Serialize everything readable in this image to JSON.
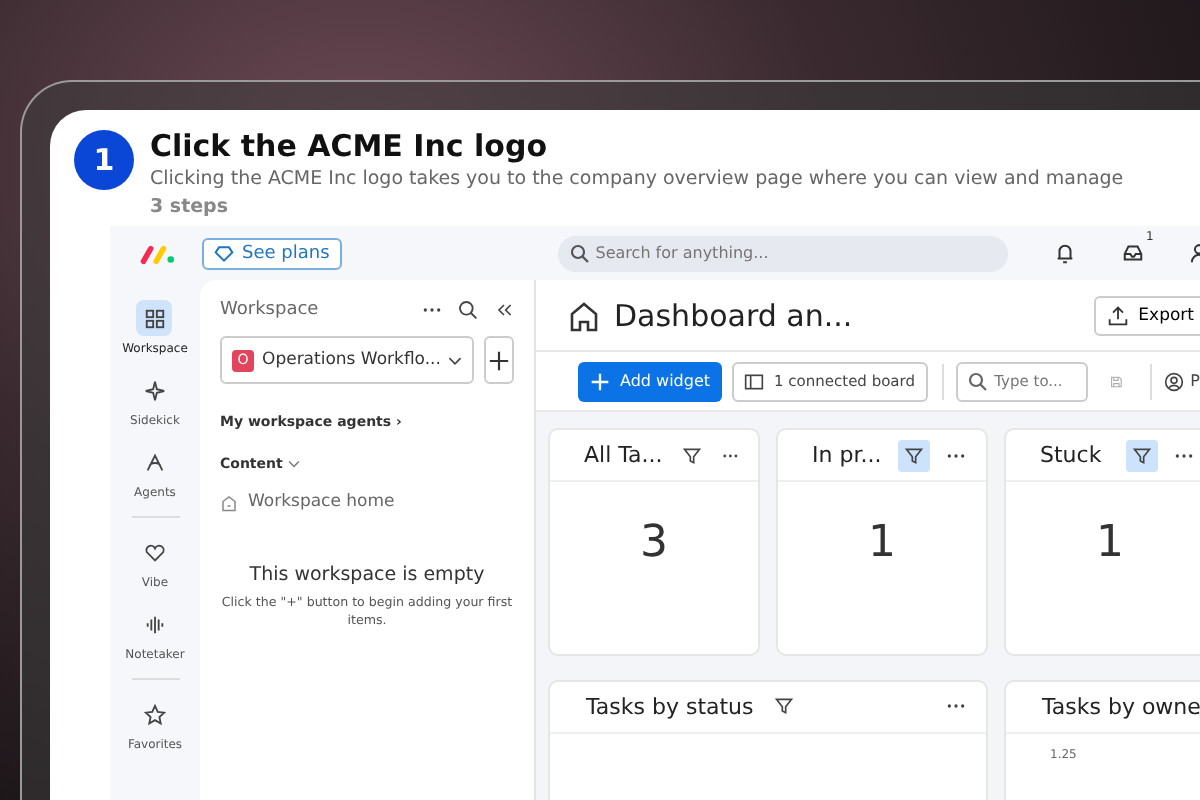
{
  "step": {
    "number": "1",
    "title": "Click the ACME Inc logo",
    "description": "Clicking the ACME Inc logo takes you to the company overview page where you can view and manage",
    "count": "3 steps"
  },
  "topbar": {
    "plans_button": "See plans",
    "search": {
      "placeholder": "Search for anything..."
    },
    "inbox_badge": "1"
  },
  "rail": [
    {
      "label": "Workspace",
      "selected": true,
      "divider_before": false
    },
    {
      "label": "Sidekick",
      "selected": false,
      "divider_before": false
    },
    {
      "label": "Agents",
      "selected": false,
      "divider_before": false
    },
    {
      "label": "Vibe",
      "selected": false,
      "divider_before": true
    },
    {
      "label": "Notetaker",
      "selected": false,
      "divider_before": false
    },
    {
      "label": "Favorites",
      "selected": false,
      "divider_before": true
    }
  ],
  "workspace": {
    "title": "Workspace",
    "selector": {
      "badge": "O",
      "name": "Operations Workflo..."
    },
    "agents_link": "My workspace agents ›",
    "content_label": "Content",
    "home_item": "Workspace home",
    "empty_title": "This workspace is empty",
    "empty_hint": "Click the \"+\" button to begin adding your first items."
  },
  "dashboard": {
    "title": "Dashboard an...",
    "export_button": "Export",
    "add_widget": "Add widget",
    "connected_board": "1 connected board",
    "filter": {
      "placeholder": "Type to..."
    },
    "person_button": "P"
  },
  "widgets": [
    {
      "title": "All Ta...",
      "value": "3",
      "filter_active": false
    },
    {
      "title": "In pr...",
      "value": "1",
      "filter_active": true
    },
    {
      "title": "Stuck",
      "value": "1",
      "filter_active": true
    }
  ],
  "charts": [
    {
      "title": "Tasks by status",
      "filter": true
    },
    {
      "title": "Tasks by owne",
      "filter": false,
      "axis_label": "1.25"
    }
  ]
}
